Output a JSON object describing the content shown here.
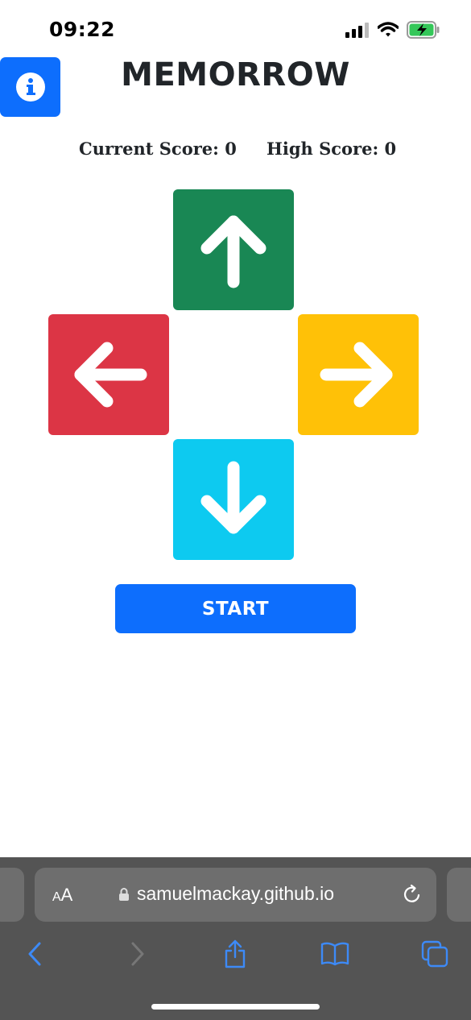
{
  "status_bar": {
    "time": "09:22",
    "icons": [
      "signal-icon",
      "wifi-icon",
      "battery-charging-icon"
    ]
  },
  "header": {
    "title": "MEMORROW",
    "info_icon": "info-icon"
  },
  "scores": {
    "current_label": "Current Score: 0",
    "high_label": "High Score: 0"
  },
  "arrows": {
    "up": {
      "icon": "arrow-up-icon",
      "color": "#198754"
    },
    "left": {
      "icon": "arrow-left-icon",
      "color": "#dc3545"
    },
    "right": {
      "icon": "arrow-right-icon",
      "color": "#ffc107"
    },
    "down": {
      "icon": "arrow-down-icon",
      "color": "#0dcaf0"
    }
  },
  "start_button": {
    "label": "START",
    "color": "#0d6efd"
  },
  "browser": {
    "text_size_label": "AA",
    "url": "samuelmackay.github.io",
    "toolbar_icons": [
      "back-icon",
      "forward-icon",
      "share-icon",
      "bookmarks-icon",
      "tabs-icon"
    ]
  }
}
